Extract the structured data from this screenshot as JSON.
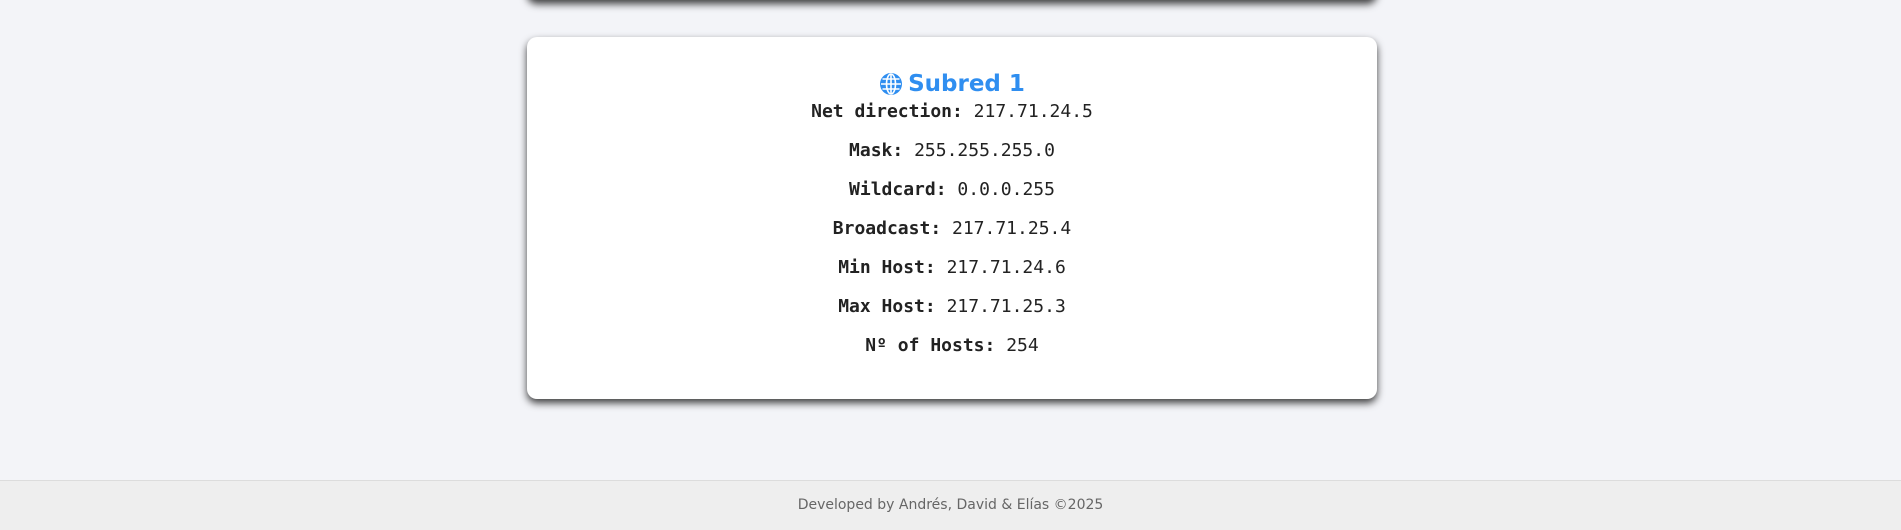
{
  "subnet": {
    "title": "Subred 1",
    "icon": "globe-icon",
    "accent_color": "#2f8ef0",
    "fields": [
      {
        "label": "Net direction:",
        "value": "217.71.24.5"
      },
      {
        "label": "Mask:",
        "value": "255.255.255.0"
      },
      {
        "label": "Wildcard:",
        "value": "0.0.0.255"
      },
      {
        "label": "Broadcast:",
        "value": "217.71.25.4"
      },
      {
        "label": "Min Host:",
        "value": "217.71.24.6"
      },
      {
        "label": "Max Host:",
        "value": "217.71.25.3"
      },
      {
        "label": "Nº of Hosts:",
        "value": "254"
      }
    ]
  },
  "footer": {
    "text": "Developed by Andrés, David & Elías ©2025"
  }
}
